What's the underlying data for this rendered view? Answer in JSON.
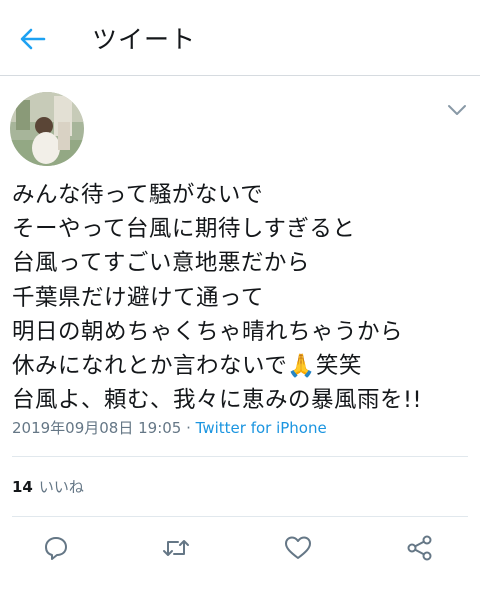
{
  "header": {
    "title": "ツイート",
    "back_icon": "arrow-left-icon",
    "accent_color": "#1da1f2"
  },
  "tweet": {
    "avatar": "user-avatar",
    "menu_icon": "chevron-down-icon",
    "lines": [
      "みんな待って騒がないで",
      "そーやって台風に期待しすぎると",
      "台風ってすごい意地悪だから",
      "千葉県だけ避けて通って",
      "明日の朝めちゃくちゃ晴れちゃうから",
      "休みになれとか言わないで🙏笑笑",
      "台風よ、頼む、我々に恵みの暴風雨を!!"
    ],
    "timestamp": "2019年09月08日 19:05 · ",
    "source": "Twitter for iPhone"
  },
  "stats": {
    "likes_count": "14",
    "likes_label": "いいね"
  },
  "actions": [
    {
      "name": "reply",
      "icon": "reply-icon"
    },
    {
      "name": "retweet",
      "icon": "retweet-icon"
    },
    {
      "name": "like",
      "icon": "heart-icon"
    },
    {
      "name": "share",
      "icon": "share-icon"
    }
  ],
  "colors": {
    "text": "#14171a",
    "secondary": "#657786",
    "link": "#1b95e0",
    "divider": "#e1e8ed"
  }
}
